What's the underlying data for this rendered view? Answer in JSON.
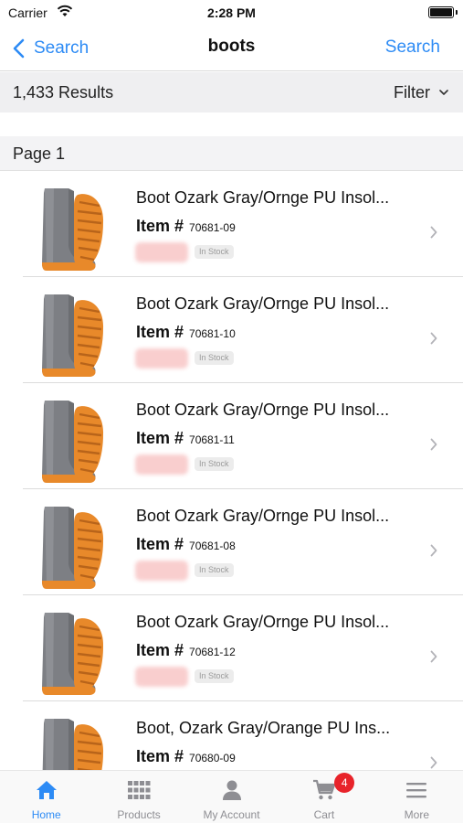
{
  "status_bar": {
    "carrier": "Carrier",
    "time": "2:28 PM"
  },
  "nav": {
    "back_label": "Search",
    "title": "boots",
    "right_label": "Search"
  },
  "results": {
    "count": "1,433 Results",
    "filter_label": "Filter"
  },
  "page_header": "Page 1",
  "products": [
    {
      "name": "Boot Ozark Gray/Ornge PU Insol...",
      "item_label": "Item #",
      "item_number": "70681-09",
      "stock": "In Stock"
    },
    {
      "name": "Boot Ozark Gray/Ornge PU Insol...",
      "item_label": "Item #",
      "item_number": "70681-10",
      "stock": "In Stock"
    },
    {
      "name": "Boot Ozark Gray/Ornge PU Insol...",
      "item_label": "Item #",
      "item_number": "70681-11",
      "stock": "In Stock"
    },
    {
      "name": "Boot Ozark Gray/Ornge PU Insol...",
      "item_label": "Item #",
      "item_number": "70681-08",
      "stock": "In Stock"
    },
    {
      "name": "Boot Ozark Gray/Ornge PU Insol...",
      "item_label": "Item #",
      "item_number": "70681-12",
      "stock": "In Stock"
    },
    {
      "name": "Boot, Ozark Gray/Orange PU Ins...",
      "item_label": "Item #",
      "item_number": "70680-09",
      "stock": ""
    }
  ],
  "tabs": [
    {
      "label": "Home",
      "icon": "home-icon",
      "active": true
    },
    {
      "label": "Products",
      "icon": "grid-icon",
      "active": false
    },
    {
      "label": "My Account",
      "icon": "person-icon",
      "active": false
    },
    {
      "label": "Cart",
      "icon": "cart-icon",
      "active": false,
      "badge": "4"
    },
    {
      "label": "More",
      "icon": "menu-icon",
      "active": false
    }
  ],
  "colors": {
    "accent": "#2d8bf5",
    "badge": "#e8232a",
    "boot_gray": "#7d7f84",
    "boot_orange": "#e8892a"
  }
}
